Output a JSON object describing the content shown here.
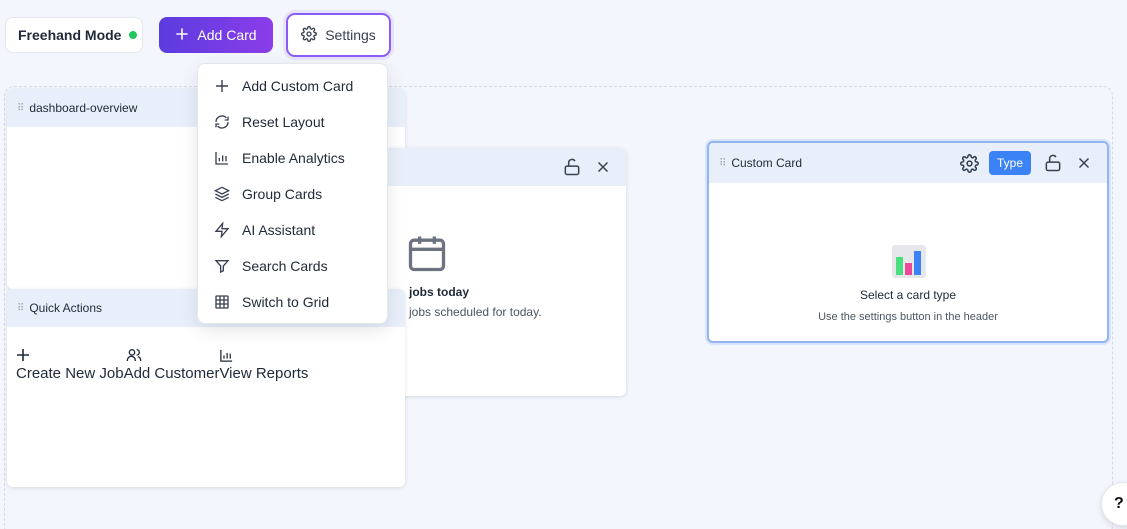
{
  "toolbar": {
    "mode_label": "Freehand Mode",
    "mode_status_color": "#22c55e",
    "add_card_label": "Add Card",
    "settings_label": "Settings"
  },
  "settings_menu": {
    "items": [
      {
        "label": "Add Custom Card",
        "icon": "plus-icon"
      },
      {
        "label": "Reset Layout",
        "icon": "refresh-icon"
      },
      {
        "label": "Enable Analytics",
        "icon": "bar-chart-icon"
      },
      {
        "label": "Group Cards",
        "icon": "layers-icon"
      },
      {
        "label": "AI Assistant",
        "icon": "zap-icon"
      },
      {
        "label": "Search Cards",
        "icon": "filter-icon"
      },
      {
        "label": "Switch to Grid",
        "icon": "grid-icon"
      }
    ]
  },
  "cards": {
    "dashboard_overview": {
      "title": "dashboard-overview"
    },
    "jobs_today": {
      "title_partial": "jobs today",
      "subtitle_partial": "jobs scheduled for today.",
      "icon": "calendar-icon"
    },
    "quick_actions": {
      "title": "Quick Actions",
      "actions": [
        {
          "label": "Create New Job",
          "icon": "plus-icon"
        },
        {
          "label": "Add Customer",
          "icon": "users-icon"
        },
        {
          "label": "View Reports",
          "icon": "bar-chart-icon"
        }
      ]
    },
    "custom_card": {
      "title": "Custom Card",
      "type_label": "Type",
      "prompt": "Select a card type",
      "hint": "Use the settings button in the header",
      "icon": "chart-emoji-icon"
    }
  },
  "colors": {
    "accent_gradient_start": "#5b3ce0",
    "accent_gradient_end": "#8b3de8",
    "settings_border": "#8b5cf6",
    "type_button": "#3b82f6",
    "card_header_bg": "#e8effb"
  }
}
